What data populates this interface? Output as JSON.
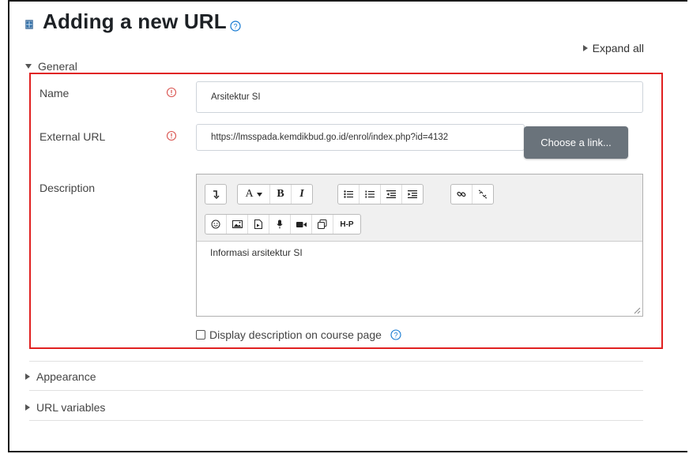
{
  "page": {
    "title": "Adding a new URL",
    "expand_all": "Expand all"
  },
  "sections": {
    "general": "General",
    "appearance": "Appearance",
    "url_variables": "URL variables"
  },
  "form": {
    "name_label": "Name",
    "name_value": "Arsitektur SI",
    "url_label": "External URL",
    "url_value": "https://lmsspada.kemdikbud.go.id/enrol/index.php?id=4132",
    "choose_link": "Choose a link...",
    "description_label": "Description",
    "description_value": "Informasi arsitektur SI",
    "display_description": "Display description on course page"
  },
  "toolbar": {
    "row1": [
      "collapse",
      "font-style",
      "bold",
      "italic",
      "unordered-list",
      "ordered-list",
      "outdent",
      "indent",
      "link",
      "unlink"
    ],
    "row2": [
      "emoji",
      "image",
      "media",
      "record-audio",
      "record-video",
      "manage-files",
      "h5p"
    ],
    "font_style_label": "A",
    "bold_label": "B",
    "italic_label": "I",
    "h5p_label": "H-P"
  },
  "colors": {
    "required": "#d9534f",
    "help": "#1177d1",
    "highlight": "#e02020",
    "button": "#6a737b"
  }
}
